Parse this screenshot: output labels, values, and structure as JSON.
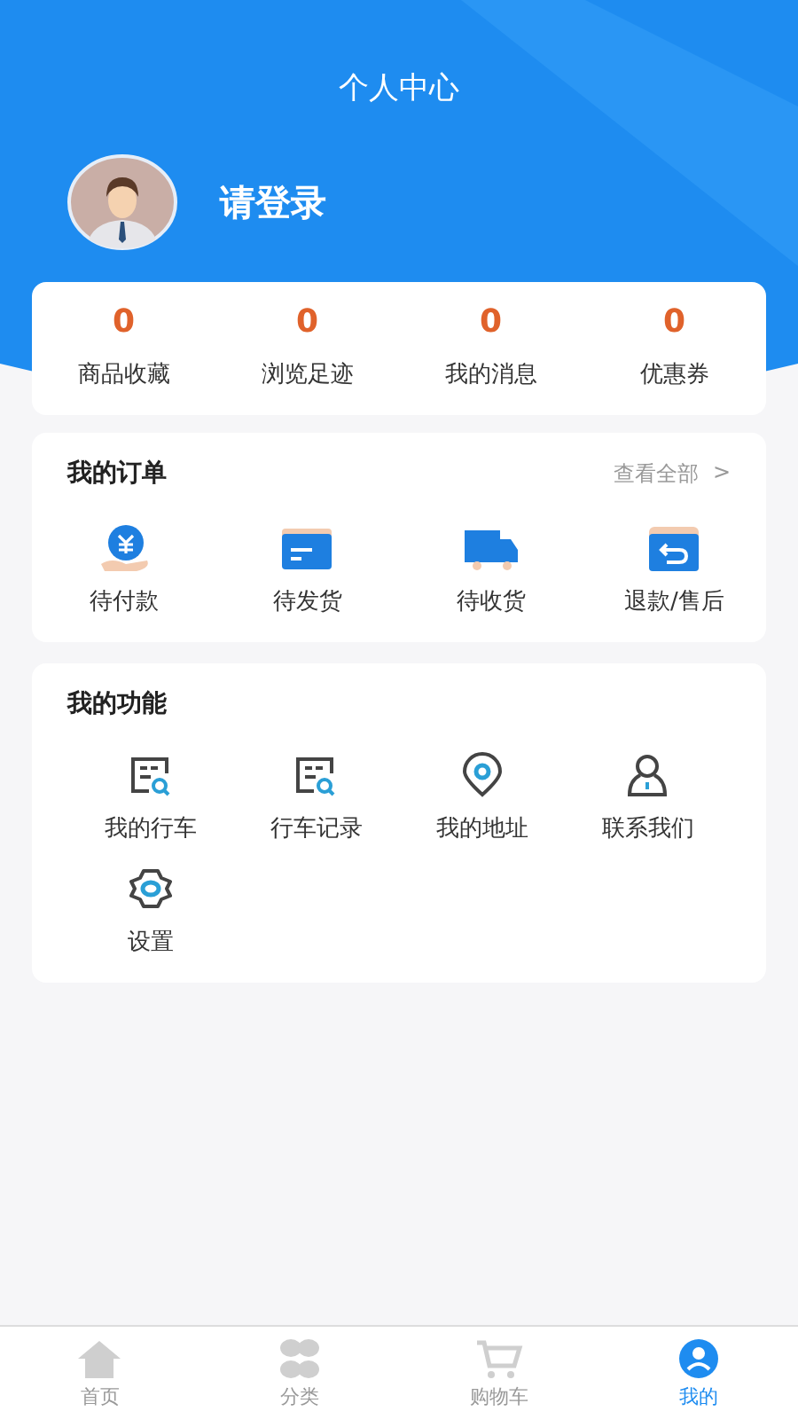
{
  "header": {
    "title": "个人中心",
    "login_label": "请登录"
  },
  "stats": [
    {
      "value": "0",
      "label": "商品收藏"
    },
    {
      "value": "0",
      "label": "浏览足迹"
    },
    {
      "value": "0",
      "label": "我的消息"
    },
    {
      "value": "0",
      "label": "优惠券"
    }
  ],
  "orders": {
    "title": "我的订单",
    "view_all": "查看全部",
    "chevron": ">",
    "items": [
      {
        "kind": "payment",
        "label": "待付款"
      },
      {
        "kind": "card",
        "label": "待发货"
      },
      {
        "kind": "truck",
        "label": "待收货"
      },
      {
        "kind": "refund",
        "label": "退款/售后"
      }
    ]
  },
  "functions": {
    "title": "我的功能",
    "items": [
      {
        "kind": "doc",
        "label": "我的行车"
      },
      {
        "kind": "doc",
        "label": "行车记录"
      },
      {
        "kind": "pin",
        "label": "我的地址"
      },
      {
        "kind": "person",
        "label": "联系我们"
      },
      {
        "kind": "gear",
        "label": "设置"
      }
    ]
  },
  "tab_bar": [
    {
      "kind": "home",
      "label": "首页",
      "selected": false
    },
    {
      "kind": "grid",
      "label": "分类",
      "selected": false
    },
    {
      "kind": "cart",
      "label": "购物车",
      "selected": false
    },
    {
      "kind": "me",
      "label": "我的",
      "selected": true
    }
  ]
}
